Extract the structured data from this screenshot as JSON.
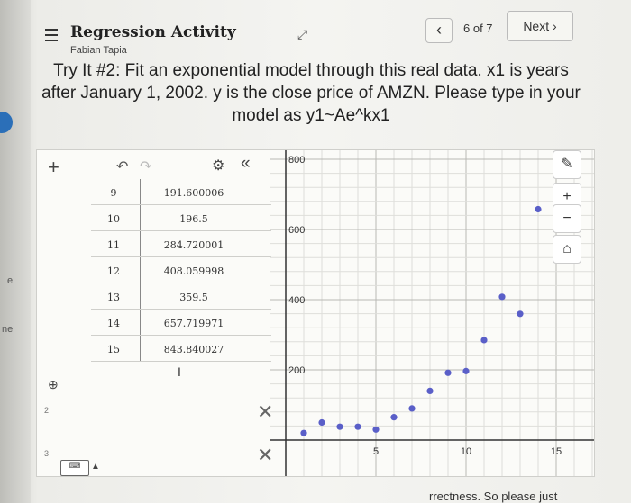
{
  "header": {
    "title": "Regression Activity",
    "subtitle": "Fabian Tapia",
    "page_count": "6 of 7",
    "next_label": "Next",
    "next_icon": "chevron-right-icon",
    "prev_icon": "chevron-left-icon"
  },
  "left_fragments": {
    "a": "e",
    "b": "ne"
  },
  "prompt": "Try It #2: Fit an exponential model through this real data. x1 is years after January 1, 2002. y is the close price of AMZN. Please type in your model as y1~Ae^kx1",
  "table": {
    "rows": [
      {
        "x": "9",
        "y": "191.600006"
      },
      {
        "x": "10",
        "y": "196.5"
      },
      {
        "x": "11",
        "y": "284.720001"
      },
      {
        "x": "12",
        "y": "408.059998"
      },
      {
        "x": "13",
        "y": "359.5"
      },
      {
        "x": "14",
        "y": "657.719971"
      },
      {
        "x": "15",
        "y": "843.840027"
      }
    ]
  },
  "expressions": {
    "num2": "2",
    "num3": "3"
  },
  "keyboard_label": "keyboard-icon",
  "graph_labels": {
    "y800": "800",
    "y600": "600",
    "y400": "400",
    "y200": "200",
    "x5": "5",
    "x10": "10",
    "x15": "15"
  },
  "footer_text": "rrectness. So please just",
  "chart_data": {
    "type": "scatter",
    "title": "",
    "xlabel": "",
    "ylabel": "",
    "xlim": [
      0,
      17.5
    ],
    "ylim": [
      0,
      850
    ],
    "x_ticks": [
      5,
      10,
      15
    ],
    "y_ticks": [
      200,
      400,
      600,
      800
    ],
    "grid": true,
    "color": "#5a5fc8",
    "points": [
      {
        "x": 1,
        "y": 20
      },
      {
        "x": 2,
        "y": 50
      },
      {
        "x": 3,
        "y": 38
      },
      {
        "x": 4,
        "y": 38
      },
      {
        "x": 5,
        "y": 30
      },
      {
        "x": 6,
        "y": 65
      },
      {
        "x": 7,
        "y": 90
      },
      {
        "x": 8,
        "y": 140
      },
      {
        "x": 9,
        "y": 191.600006
      },
      {
        "x": 10,
        "y": 196.5
      },
      {
        "x": 11,
        "y": 284.720001
      },
      {
        "x": 12,
        "y": 408.059998
      },
      {
        "x": 13,
        "y": 359.5
      },
      {
        "x": 14,
        "y": 657.719971
      },
      {
        "x": 15,
        "y": 843.840027
      }
    ]
  }
}
